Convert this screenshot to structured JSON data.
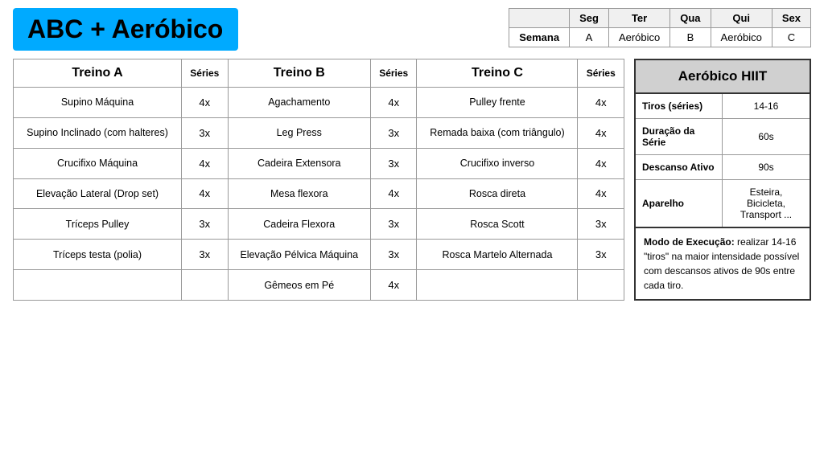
{
  "header": {
    "title": "ABC + Aeróbico",
    "schedule": {
      "days": [
        "Seg",
        "Ter",
        "Qua",
        "Qui",
        "Sex"
      ],
      "row_label": "Semana",
      "row_values": [
        "A",
        "Aeróbico",
        "B",
        "Aeróbico",
        "C"
      ]
    }
  },
  "treino_a": {
    "header": "Treino A",
    "series_label": "Séries",
    "exercises": [
      {
        "name": "Supino Máquina",
        "series": "4x"
      },
      {
        "name": "Supino Inclinado (com halteres)",
        "series": "3x"
      },
      {
        "name": "Crucifixo Máquina",
        "series": "4x"
      },
      {
        "name": "Elevação Lateral (Drop set)",
        "series": "4x"
      },
      {
        "name": "Tríceps Pulley",
        "series": "3x"
      },
      {
        "name": "Tríceps testa (polia)",
        "series": "3x"
      },
      {
        "name": "",
        "series": ""
      }
    ]
  },
  "treino_b": {
    "header": "Treino B",
    "series_label": "Séries",
    "exercises": [
      {
        "name": "Agachamento",
        "series": "4x"
      },
      {
        "name": "Leg Press",
        "series": "3x"
      },
      {
        "name": "Cadeira Extensora",
        "series": "3x"
      },
      {
        "name": "Mesa flexora",
        "series": "4x"
      },
      {
        "name": "Cadeira Flexora",
        "series": "3x"
      },
      {
        "name": "Elevação Pélvica Máquina",
        "series": "3x"
      },
      {
        "name": "Gêmeos em Pé",
        "series": "4x"
      }
    ]
  },
  "treino_c": {
    "header": "Treino C",
    "series_label": "Séries",
    "exercises": [
      {
        "name": "Pulley frente",
        "series": "4x"
      },
      {
        "name": "Remada baixa (com triângulo)",
        "series": "4x"
      },
      {
        "name": "Crucifixo inverso",
        "series": "4x"
      },
      {
        "name": "Rosca direta",
        "series": "4x"
      },
      {
        "name": "Rosca Scott",
        "series": "3x"
      },
      {
        "name": "Rosca Martelo Alternada",
        "series": "3x"
      },
      {
        "name": "",
        "series": ""
      }
    ]
  },
  "aerobico": {
    "title": "Aeróbico HIIT",
    "rows": [
      {
        "label": "Tiros (séries)",
        "value": "14-16"
      },
      {
        "label": "Duração da Série",
        "value": "60s"
      },
      {
        "label": "Descanso Ativo",
        "value": "90s"
      },
      {
        "label": "Aparelho",
        "value": "Esteira, Bicicleta, Transport ..."
      }
    ],
    "note_bold": "Modo de Execução:",
    "note_text": " realizar 14-16 \"tiros\" na maior intensidade possível com descansos ativos de 90s entre cada tiro."
  }
}
